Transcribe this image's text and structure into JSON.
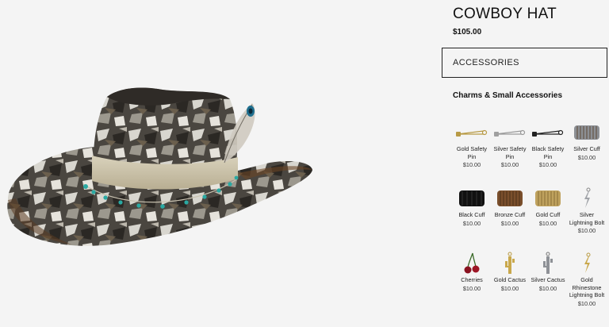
{
  "product": {
    "title": "COWBOY HAT",
    "price": "$105.00"
  },
  "accessories_label": "ACCESSORIES",
  "section_heading": "Charms & Small Accessories",
  "items": [
    {
      "name": "Gold Safety Pin",
      "price": "$10.00",
      "icon": "safety-pin-icon"
    },
    {
      "name": "Silver Safety Pin",
      "price": "$10.00",
      "icon": "safety-pin-icon"
    },
    {
      "name": "Black Safety Pin",
      "price": "$10.00",
      "icon": "safety-pin-icon"
    },
    {
      "name": "Silver Cuff",
      "price": "$10.00",
      "icon": "cuff-icon"
    },
    {
      "name": "Black Cuff",
      "price": "$10.00",
      "icon": "cuff-icon"
    },
    {
      "name": "Bronze Cuff",
      "price": "$10.00",
      "icon": "cuff-icon"
    },
    {
      "name": "Gold Cuff",
      "price": "$10.00",
      "icon": "cuff-icon"
    },
    {
      "name": "Silver Lightning Bolt",
      "price": "$10.00",
      "icon": "lightning-bolt-charm-icon"
    },
    {
      "name": "Cherries",
      "price": "$10.00",
      "icon": "cherries-charm-icon"
    },
    {
      "name": "Gold Cactus",
      "price": "$10.00",
      "icon": "cactus-charm-icon"
    },
    {
      "name": "Silver Cactus",
      "price": "$10.00",
      "icon": "cactus-charm-icon"
    },
    {
      "name": "Gold Rhinestone Lightning Bolt",
      "price": "$10.00",
      "icon": "lightning-bolt-charm-icon"
    }
  ],
  "colors": {
    "background": "#f4f4f4",
    "text": "#111111",
    "hat_band": "#cfc6ad",
    "turquoise": "#2aa9a2"
  }
}
